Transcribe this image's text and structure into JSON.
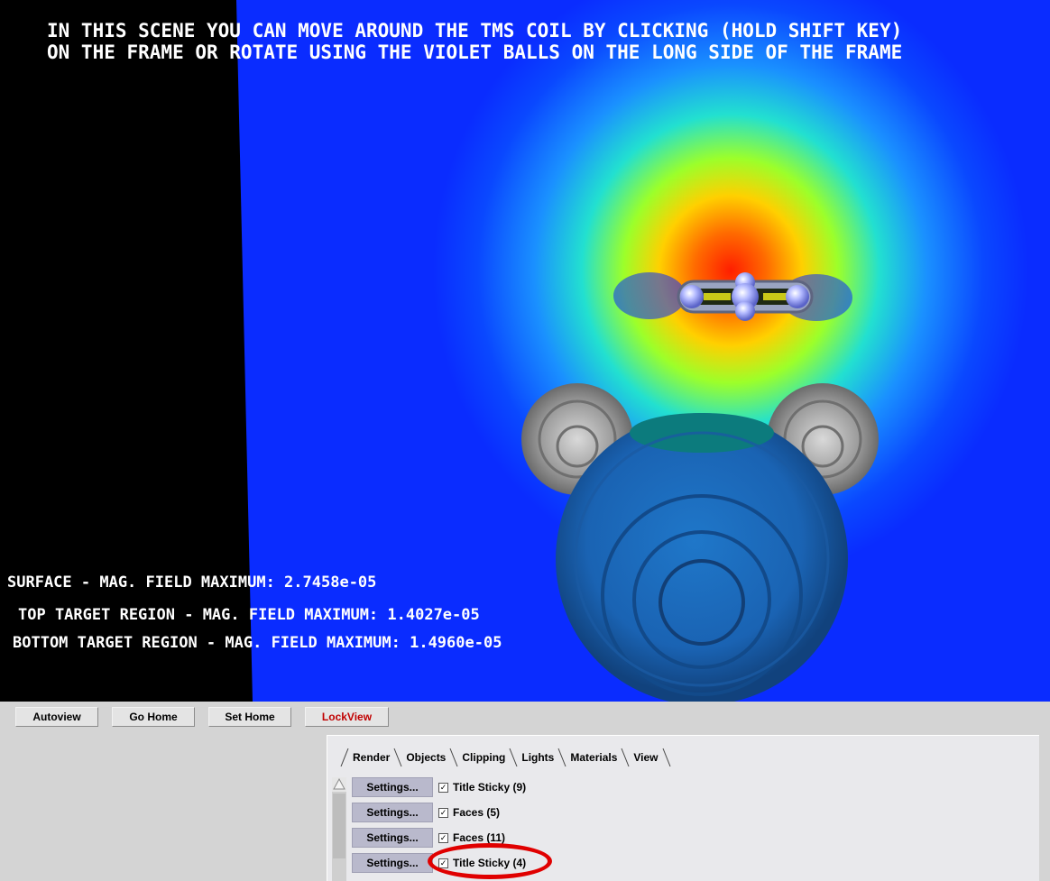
{
  "overlay": {
    "instructions_line1": "IN THIS SCENE YOU CAN MOVE AROUND THE TMS COIL BY CLICKING (HOLD SHIFT KEY)",
    "instructions_line2": "ON THE FRAME OR ROTATE USING THE VIOLET BALLS ON THE LONG SIDE OF THE FRAME",
    "readouts": [
      "SURFACE - MAG. FIELD MAXIMUM: 2.7458e-05",
      "TOP TARGET REGION - MAG. FIELD MAXIMUM: 1.4027e-05",
      "BOTTOM TARGET REGION - MAG. FIELD MAXIMUM: 1.4960e-05"
    ]
  },
  "toolbar": {
    "autoview": "Autoview",
    "go_home": "Go Home",
    "set_home": "Set Home",
    "lockview": "LockView"
  },
  "tabs": [
    {
      "label": "Render"
    },
    {
      "label": "Objects",
      "active": true
    },
    {
      "label": "Clipping"
    },
    {
      "label": "Lights"
    },
    {
      "label": "Materials"
    },
    {
      "label": "View"
    }
  ],
  "objects": [
    {
      "settings": "Settings...",
      "checked": true,
      "label": "Title Sticky (9)"
    },
    {
      "settings": "Settings...",
      "checked": true,
      "label": "Faces (5)"
    },
    {
      "settings": "Settings...",
      "checked": true,
      "label": "Faces (11)",
      "highlighted": true
    },
    {
      "settings": "Settings...",
      "checked": true,
      "label": "Title Sticky (4)"
    }
  ],
  "colors": {
    "background_field": "#0a2cff",
    "field_hot": "#ff2a00",
    "model_blue": "#1b6fc8",
    "model_grey": "#9a9a9a",
    "coil": "#9aa8e8",
    "highlight": "#e00000",
    "lockview_text": "#c00000"
  },
  "icons": {
    "checkbox_mark": "✓",
    "scroll_up": "up-arrow-icon"
  }
}
